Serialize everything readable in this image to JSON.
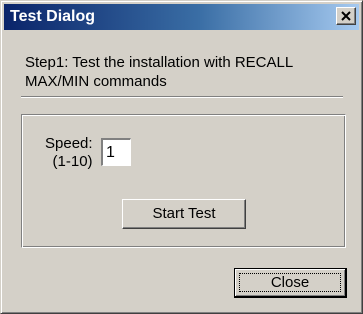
{
  "window": {
    "title": "Test Dialog",
    "close_glyph": "×",
    "close_icon": "close-icon"
  },
  "step": {
    "line1": "Step1: Test the installation with RECALL",
    "line2": "MAX/MIN commands"
  },
  "speed": {
    "label_line1": "Speed:",
    "label_line2": "(1-10)",
    "value": "1"
  },
  "buttons": {
    "start_test": "Start Test",
    "close": "Close"
  },
  "colors": {
    "titlebar_start": "#0a246a",
    "titlebar_end": "#a6caf0",
    "face": "#d4d0c8"
  }
}
